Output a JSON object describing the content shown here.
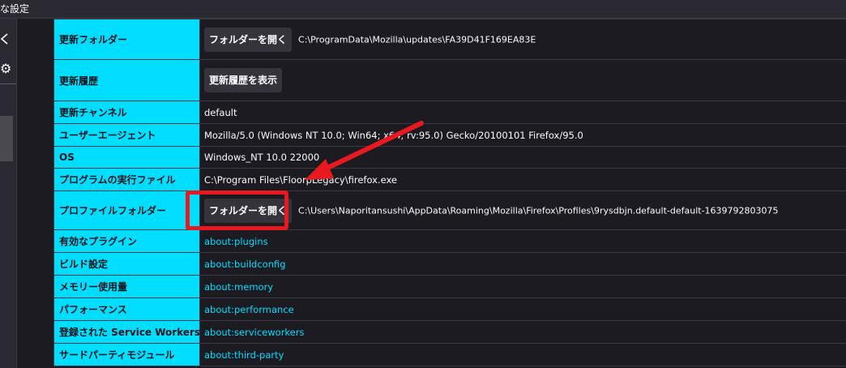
{
  "window": {
    "title": "な設定"
  },
  "sidebar": {
    "back_icon": "chevron-left-icon",
    "gear_glyph": "⚙",
    "gear_icon": "gear-icon"
  },
  "rows": [
    {
      "key": "更新フォルダー",
      "button": "フォルダーを開く",
      "value": "C:\\ProgramData\\Mozilla\\updates\\FA39D41F169EA83E"
    },
    {
      "key": "更新履歴",
      "button": "更新履歴を表示"
    },
    {
      "key": "更新チャンネル",
      "value": "default"
    },
    {
      "key": "ユーザーエージェント",
      "value": "Mozilla/5.0 (Windows NT 10.0; Win64; x64; rv:95.0) Gecko/20100101 Firefox/95.0"
    },
    {
      "key": "OS",
      "value": "Windows_NT 10.0 22000"
    },
    {
      "key": "プログラムの実行ファイル",
      "value": "C:\\Program Files\\FloorpLegacy\\firefox.exe"
    },
    {
      "key": "プロファイルフォルダー",
      "button": "フォルダーを開く",
      "value": "C:\\Users\\Naporitansushi\\AppData\\Roaming\\Mozilla\\Firefox\\Profiles\\9rysdbjn.default-default-1639792803075"
    },
    {
      "key": "有効なプラグイン",
      "link": "about:plugins"
    },
    {
      "key": "ビルド設定",
      "link": "about:buildconfig"
    },
    {
      "key": "メモリー使用量",
      "link": "about:memory"
    },
    {
      "key": "パフォーマンス",
      "link": "about:performance"
    },
    {
      "key": "登録された Service Workers",
      "link": "about:serviceworkers"
    },
    {
      "key": "サードパーティモジュール",
      "link": "about:third-party"
    }
  ],
  "annotation": {
    "highlight_color": "#e8191f",
    "arrow_color": "#e8191f"
  },
  "colors": {
    "key_cell": "#00ddff",
    "background": "#1c1b22",
    "button": "#35343c",
    "link": "#00ddff"
  }
}
